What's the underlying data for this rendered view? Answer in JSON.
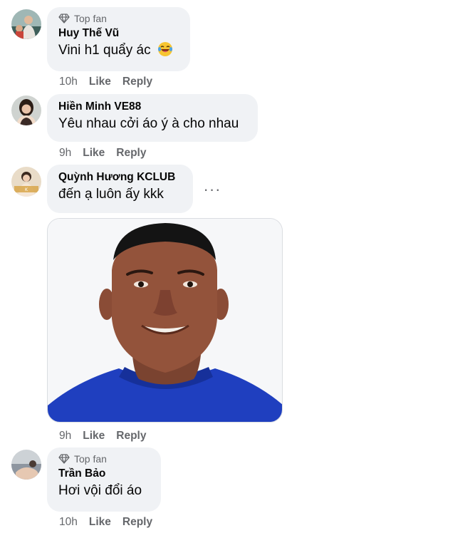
{
  "comments": [
    {
      "badge": "Top fan",
      "author": "Huy Thế Vũ",
      "text": "Vini h1 quẩy ác",
      "emoji": "laughing-tears-emoji",
      "time": "10h",
      "like": "Like",
      "reply": "Reply"
    },
    {
      "author": "Hiền Minh VE88",
      "text": "Yêu nhau cởi áo ý à cho nhau",
      "time": "9h",
      "like": "Like",
      "reply": "Reply"
    },
    {
      "author": "Quỳnh Hương KCLUB",
      "text": "đến ạ luôn ấy kkk",
      "more": "···",
      "attachment": "photo-of-smiling-man-in-blue-shirt",
      "time": "9h",
      "like": "Like",
      "reply": "Reply"
    },
    {
      "badge": "Top fan",
      "author": "Trần Bảo",
      "text": "Hơi vội đổi áo",
      "time": "10h",
      "like": "Like",
      "reply": "Reply"
    }
  ],
  "colors": {
    "bubble": "#f0f2f5",
    "secondary_text": "#65676b",
    "primary_text": "#050505",
    "shirt_blue": "#1d3fbf"
  }
}
